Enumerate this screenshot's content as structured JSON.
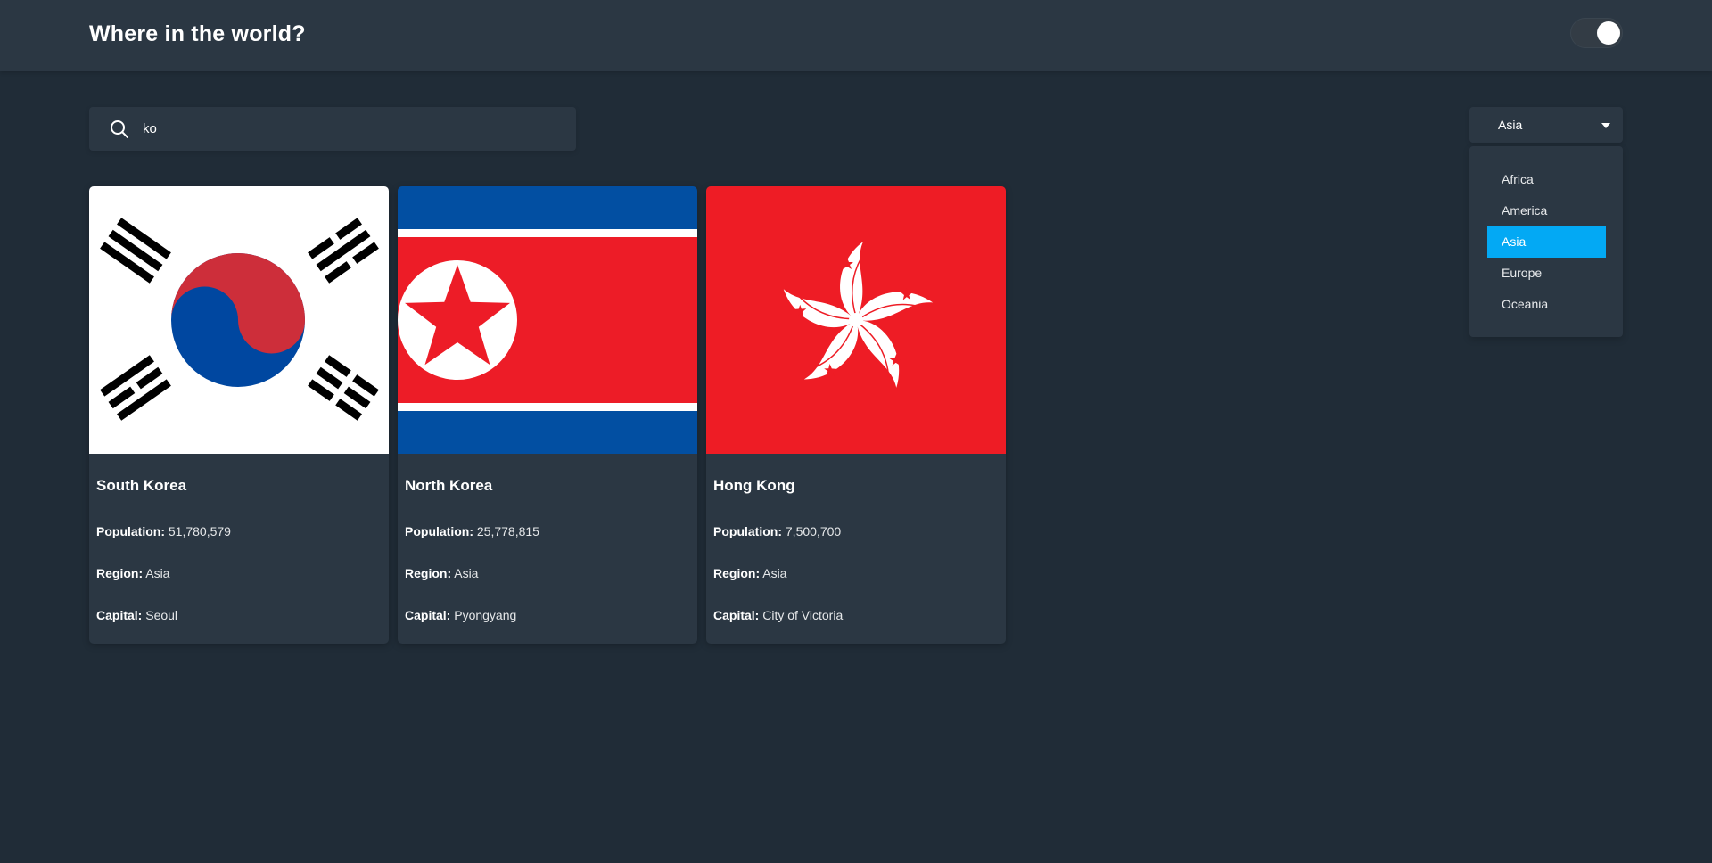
{
  "header": {
    "title": "Where in the world?",
    "theme_toggle": "dark-mode-toggle"
  },
  "search": {
    "value": "ko",
    "icon": "search-icon"
  },
  "filter": {
    "selected": "Asia",
    "options": [
      "Africa",
      "America",
      "Asia",
      "Europe",
      "Oceania"
    ]
  },
  "labels": {
    "population": "Population:",
    "region": "Region:",
    "capital": "Capital:"
  },
  "countries": [
    {
      "name": "South Korea",
      "population": "51,780,579",
      "region": "Asia",
      "capital": "Seoul",
      "flag": "south-korea-flag"
    },
    {
      "name": "North Korea",
      "population": "25,778,815",
      "region": "Asia",
      "capital": "Pyongyang",
      "flag": "north-korea-flag"
    },
    {
      "name": "Hong Kong",
      "population": "7,500,700",
      "region": "Asia",
      "capital": "City of Victoria",
      "flag": "hong-kong-flag"
    }
  ],
  "colors": {
    "background": "#202c37",
    "surface": "#2b3743",
    "accent": "#03a9f4"
  }
}
